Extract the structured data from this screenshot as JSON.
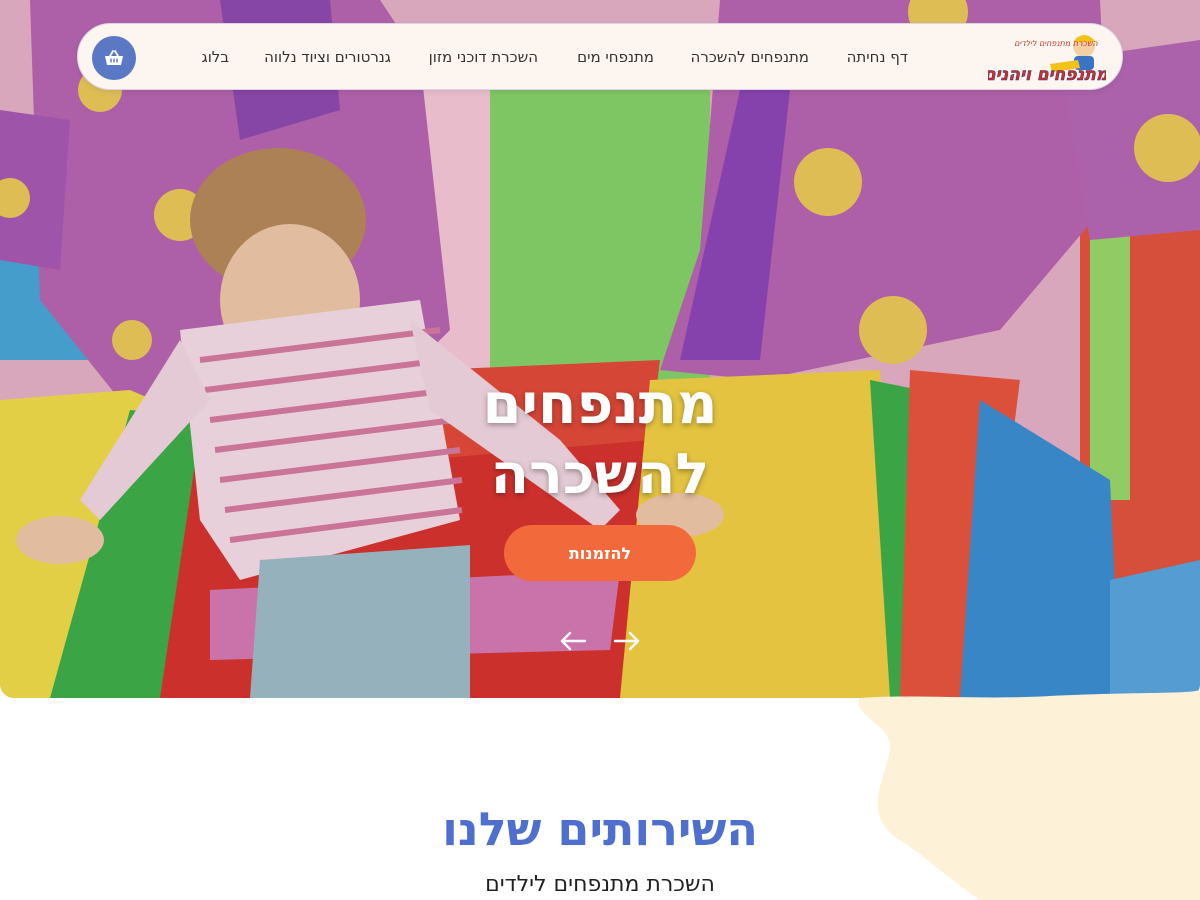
{
  "brand": {
    "logo_alt": "מתנפחים ויהנים",
    "logo_tagline": "השכרת מתנפחים לילדים",
    "colors": {
      "accent": "#f26a3b",
      "primary": "#5b78c4",
      "heading": "#4f6fcf",
      "nav_bg": "#fdf5ef",
      "blob": "#fdf1d8"
    }
  },
  "nav": {
    "items": [
      {
        "label": "דף נחיתה"
      },
      {
        "label": "מתנפחים להשכרה"
      },
      {
        "label": "מתנפחי מים"
      },
      {
        "label": "השכרת דוכני מזון"
      },
      {
        "label": "גנרטורים וציוד נלווה"
      },
      {
        "label": "בלוג"
      }
    ],
    "cart_icon": "basket-icon"
  },
  "hero": {
    "title_line1": "מתנפחים",
    "title_line2": "להשכרה",
    "cta_label": "להזמנות",
    "prev_icon": "arrow-left-icon",
    "next_icon": "arrow-right-icon"
  },
  "services": {
    "title": "השירותים שלנו",
    "subtitle": "השכרת מתנפחים לילדים"
  }
}
